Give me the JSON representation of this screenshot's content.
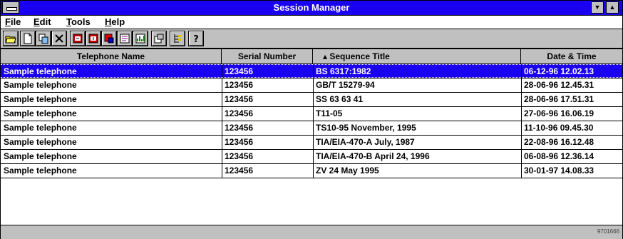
{
  "window": {
    "title": "Session Manager",
    "controls": {
      "minimize_icon": "down-arrow",
      "maximize_icon": "up-arrow"
    }
  },
  "menu": [
    {
      "label": "File"
    },
    {
      "label": "Edit"
    },
    {
      "label": "Tools"
    },
    {
      "label": "Help"
    }
  ],
  "toolbar": [
    {
      "icon": "open-folder-icon"
    },
    {
      "icon": "new-document-icon"
    },
    {
      "icon": "copy-icon"
    },
    {
      "icon": "delete-icon"
    },
    {
      "icon": "export-icon"
    },
    {
      "icon": "import-icon"
    },
    {
      "icon": "telephone-icon"
    },
    {
      "icon": "report-icon"
    },
    {
      "icon": "chart-icon"
    },
    {
      "icon": "properties-icon"
    },
    {
      "icon": "tree-view-icon"
    },
    {
      "icon": "help-icon"
    }
  ],
  "table": {
    "columns": [
      "Telephone Name",
      "Serial Number",
      "▴ Sequence Title",
      "Date & Time"
    ],
    "rows": [
      {
        "name": "Sample telephone",
        "serial": "123456",
        "title": "BS 6317:1982",
        "datetime": "06-12-96 12.02.13",
        "selected": true
      },
      {
        "name": "Sample telephone",
        "serial": "123456",
        "title": "GB/T 15279-94",
        "datetime": "28-06-96 12.45.31"
      },
      {
        "name": "Sample telephone",
        "serial": "123456",
        "title": "SS 63 63 41",
        "datetime": "28-06-96 17.51.31"
      },
      {
        "name": "Sample telephone",
        "serial": "123456",
        "title": "T11-05",
        "datetime": "27-06-96 16.06.19"
      },
      {
        "name": "Sample telephone",
        "serial": "123456",
        "title": "TS10-95 November, 1995",
        "datetime": "11-10-96 09.45.30"
      },
      {
        "name": "Sample telephone",
        "serial": "123456",
        "title": "TIA/EIA-470-A July, 1987",
        "datetime": "22-08-96 16.12.48"
      },
      {
        "name": "Sample telephone",
        "serial": "123456",
        "title": "TIA/EIA-470-B April 24, 1996",
        "datetime": "06-08-96 12.36.14"
      },
      {
        "name": "Sample telephone",
        "serial": "123456",
        "title": "ZV 24 May 1995",
        "datetime": "30-01-97 14.08.33"
      }
    ]
  },
  "status": {
    "figure_code": "9701666"
  },
  "colors": {
    "titlebar": "#1a00f0",
    "selection": "#1a00f0",
    "face": "#c0c0c0"
  }
}
